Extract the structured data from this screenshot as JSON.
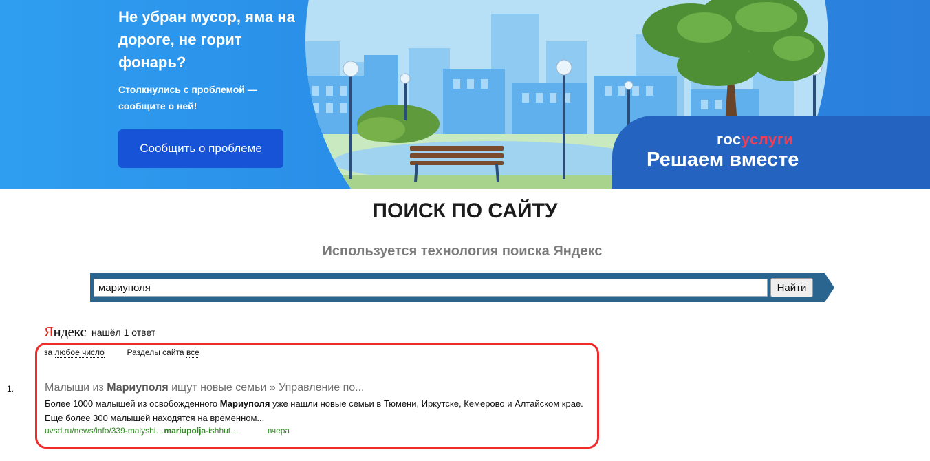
{
  "banner": {
    "title": "Не убран мусор, яма на дороге, не горит фонарь?",
    "subtitle": "Столкнулись с проблемой — сообщите о ней!",
    "button_label": "Сообщить о проблеме",
    "logo_gos": "гос",
    "logo_uslugi": "услуги",
    "slogan": "Решаем вместе"
  },
  "search": {
    "title": "ПОИСК ПО САЙТУ",
    "subtitle": "Используется технология поиска Яндекс",
    "query": "мариуполя",
    "button_label": "Найти"
  },
  "results": {
    "engine_logo_first": "Я",
    "engine_logo_rest": "ндекс",
    "found_text": "нашёл 1 ответ",
    "filter_period_prefix": "за",
    "filter_period_link": "любое число",
    "filter_sections_prefix": "Разделы сайта",
    "filter_sections_link": "все",
    "items": [
      {
        "number": "1.",
        "title_before": "Малыши из ",
        "title_bold": "Мариуполя",
        "title_after": " ищут новые семьи » Управление по...",
        "snippet_before": "Более 1000 малышей из освобожденного ",
        "snippet_bold": "Мариуполя",
        "snippet_after": " уже нашли новые семьи в Тюмени, Иркутске, Кемерово и Алтайском крае. Еще более 300 малышей находятся на временном...",
        "url_before": "uvsd.ru/news/info/339-malyshi…",
        "url_bold": "mariupolja",
        "url_after": "-ishhut…",
        "date": "вчера"
      }
    ]
  },
  "colors": {
    "banner_bg": "#2a8fe8",
    "button_bg": "#1753d6",
    "search_bar": "#2a6590",
    "highlight_border": "#ef2b2b",
    "url_green": "#2e8b1f",
    "gos_red": "#ee3f58"
  }
}
